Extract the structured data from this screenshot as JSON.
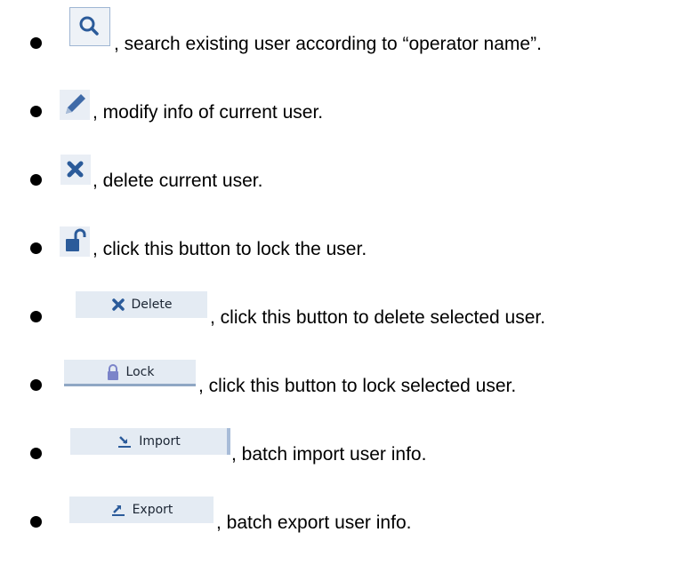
{
  "items": [
    {
      "icon": "search-icon",
      "text": ", search existing user according to “operator name”."
    },
    {
      "icon": "pencil-icon",
      "text": ", modify info of current user."
    },
    {
      "icon": "close-icon",
      "text": ", delete current user."
    },
    {
      "icon": "unlock-icon",
      "text": ", click this button to lock the user."
    },
    {
      "icon": "close-icon",
      "button_label": "Delete",
      "text": ", click this button to delete selected user."
    },
    {
      "icon": "lock-icon",
      "button_label": "Lock",
      "text": ", click this button to lock selected user."
    },
    {
      "icon": "import-icon",
      "button_label": "Import",
      "text": ", batch import user info."
    },
    {
      "icon": "export-icon",
      "button_label": "Export",
      "text": ", batch export user info."
    }
  ],
  "colors": {
    "icon_bg": "#e9eef5",
    "button_bg": "#e4ebf3",
    "icon_blue": "#2b5b9a",
    "text": "#000000"
  }
}
